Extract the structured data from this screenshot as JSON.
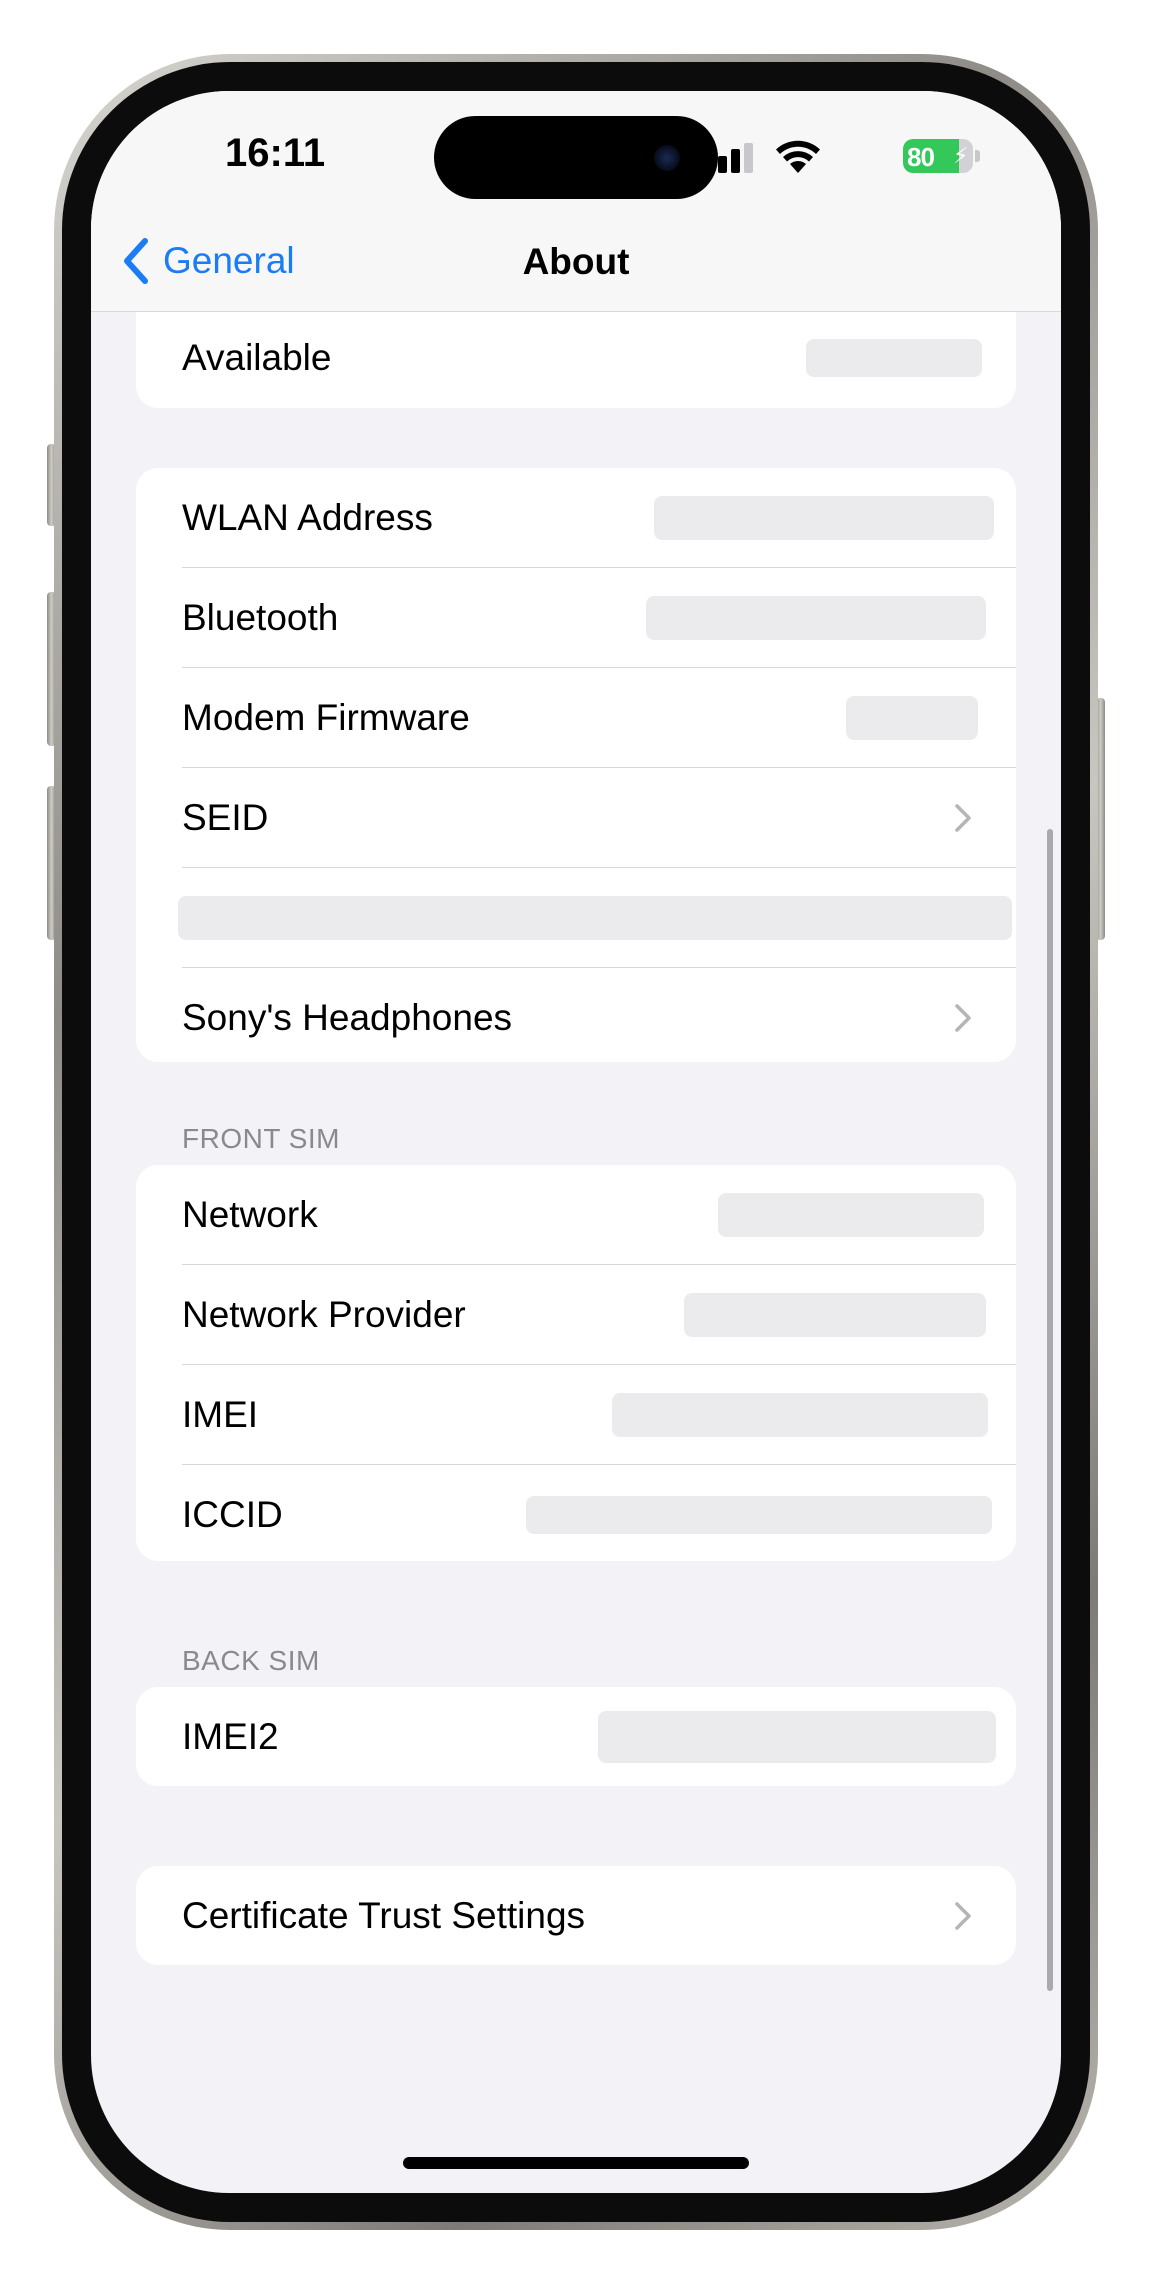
{
  "status_bar": {
    "time": "16:11",
    "battery_text": "80",
    "battery_level": 0.8,
    "icons": [
      "cellular-signal-icon",
      "wifi-icon",
      "battery-charging-icon"
    ]
  },
  "nav": {
    "back_label": "General",
    "title": "About"
  },
  "groups": {
    "storage": {
      "rows": [
        {
          "label": "Available"
        }
      ]
    },
    "network_info": {
      "rows": [
        {
          "label": "WLAN Address"
        },
        {
          "label": "Bluetooth"
        },
        {
          "label": "Modem Firmware"
        },
        {
          "label": "SEID"
        },
        {
          "label": ""
        },
        {
          "label": "Sony's Headphones"
        }
      ]
    },
    "front_sim": {
      "header": "FRONT SIM",
      "rows": [
        {
          "label": "Network"
        },
        {
          "label": "Network Provider"
        },
        {
          "label": "IMEI"
        },
        {
          "label": "ICCID"
        }
      ]
    },
    "back_sim": {
      "header": "BACK SIM",
      "rows": [
        {
          "label": "IMEI2"
        }
      ]
    },
    "certificates": {
      "rows": [
        {
          "label": "Certificate Trust Settings"
        }
      ]
    }
  },
  "colors": {
    "accent": "#1a7df5",
    "background": "#f2f2f7",
    "battery": "#34c759",
    "secondary_text": "#8a8a8e"
  }
}
